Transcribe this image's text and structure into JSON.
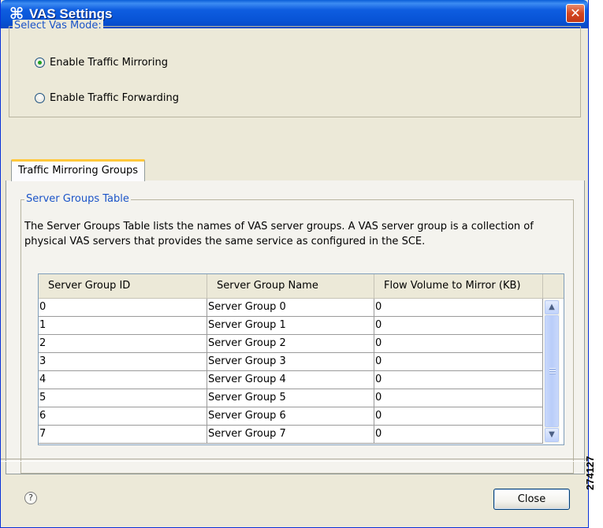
{
  "window": {
    "title": "VAS Settings",
    "title_icon": "command-key-icon",
    "close_glyph": "✕"
  },
  "vas_mode": {
    "legend": "Select Vas Mode:",
    "options": [
      {
        "label": "Enable Traffic Mirroring",
        "checked": true
      },
      {
        "label": "Enable Traffic Forwarding",
        "checked": false
      }
    ]
  },
  "tabs": [
    {
      "label": "Traffic Mirroring Groups",
      "active": true
    }
  ],
  "server_groups": {
    "legend": "Server Groups Table",
    "description": "The Server Groups Table lists the names of VAS server groups. A VAS server group is a collection of physical VAS servers that provides the same service as configured in the SCE.",
    "columns": [
      "Server Group ID",
      "Server Group Name",
      "Flow Volume to Mirror (KB)"
    ],
    "rows": [
      [
        "0",
        "Server Group 0",
        "0"
      ],
      [
        "1",
        "Server Group 1",
        "0"
      ],
      [
        "2",
        "Server Group 2",
        "0"
      ],
      [
        "3",
        "Server Group 3",
        "0"
      ],
      [
        "4",
        "Server Group 4",
        "0"
      ],
      [
        "5",
        "Server Group 5",
        "0"
      ],
      [
        "6",
        "Server Group 6",
        "0"
      ],
      [
        "7",
        "Server Group 7",
        "0"
      ]
    ]
  },
  "footer": {
    "help_glyph": "?",
    "close_label": "Close"
  },
  "figure_id": "274127",
  "colors": {
    "titlebar": "#0854d6",
    "legend_text": "#1b54c8",
    "window_bg": "#ece9d8",
    "tab_highlight": "#ffc83c",
    "radio_dot": "#21a121"
  }
}
